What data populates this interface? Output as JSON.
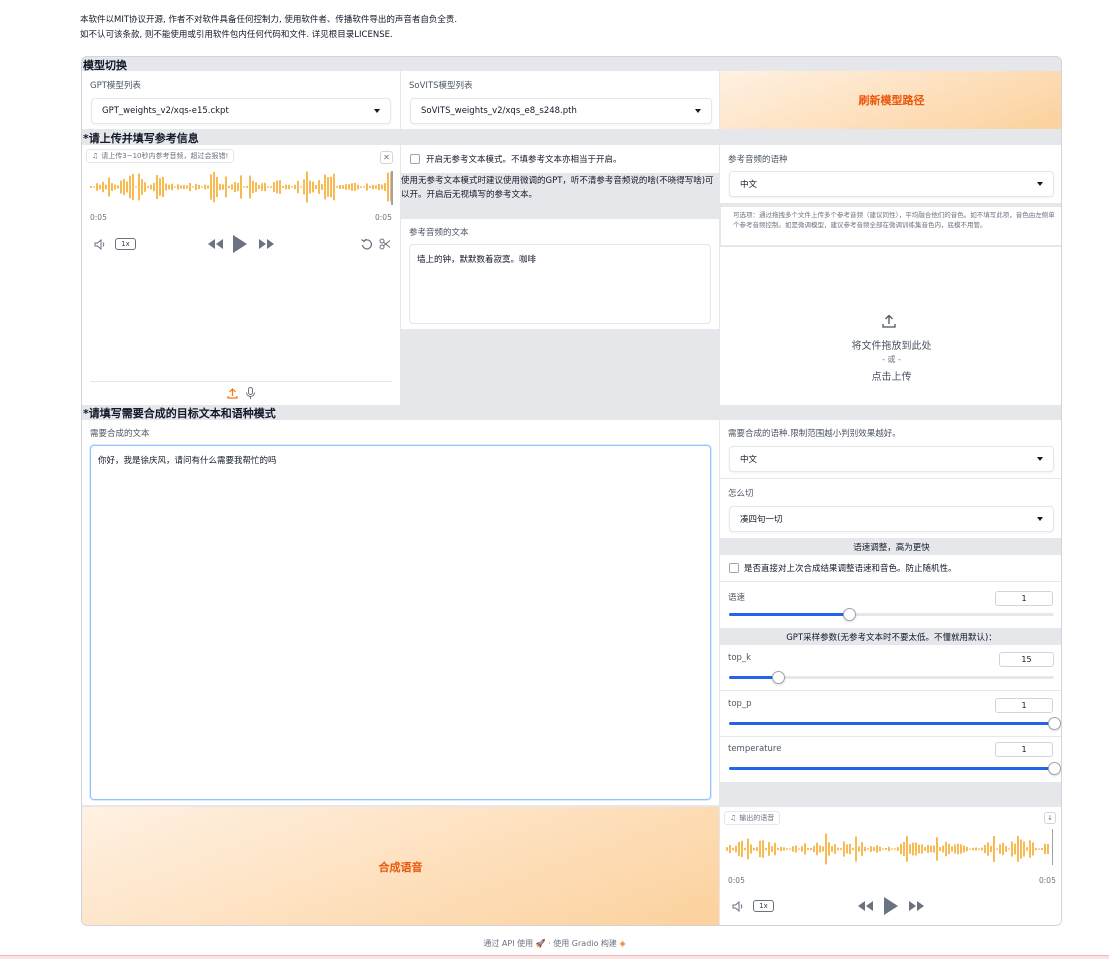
{
  "notice": {
    "line1": "本软件以MIT协议开源, 作者不对软件具备任何控制力, 使用软件者、传播软件导出的声音者自负全责.",
    "line2": "如不认可该条款, 则不能使用或引用软件包内任何代码和文件. 详见根目录LICENSE."
  },
  "model_switch": {
    "title": "模型切换",
    "gpt_label": "GPT模型列表",
    "gpt_value": "GPT_weights_v2/xqs-e15.ckpt",
    "sovits_label": "SoVITS模型列表",
    "sovits_value": "SoVITS_weights_v2/xqs_e8_s248.pth",
    "refresh_button": "刷新模型路径"
  },
  "reference": {
    "title": "*请上传并填写参考信息",
    "audio_chip": "请上传3~10秒内参考音频，超过会报错!",
    "audio_time_left": "0:05",
    "audio_time_right": "0:05",
    "audio_rate": "1x",
    "no_ref_checkbox_label": "开启无参考文本模式。不填参考文本亦相当于开启。",
    "no_ref_hint": "使用无参考文本模式时建议使用微调的GPT，听不清参考音频说的啥(不晓得写啥)可以开。开启后无视填写的参考文本。",
    "ref_text_label": "参考音频的文本",
    "ref_text_value": "墙上的钟，默默数着寂寞。咖啡",
    "ref_lang_label": "参考音频的语种",
    "ref_lang_value": "中文",
    "optional_hint": "可选项：通过拖拽多个文件上传多个参考音频（建议同性），平均融合他们的音色。如不填写此项，音色由左侧单个参考音频控制。如是微调模型，建议参考音频全部在微调训练集音色内，底模不用管。",
    "upload_line1": "将文件拖放到此处",
    "upload_line2": "- 或 -",
    "upload_line3": "点击上传"
  },
  "target": {
    "title": "*请填写需要合成的目标文本和语种模式",
    "text_label": "需要合成的文本",
    "text_value": "你好，我是徐庆风，请问有什么需要我帮忙的吗",
    "lang_label": "需要合成的语种.限制范围越小判别效果越好。",
    "lang_value": "中文",
    "cut_label": "怎么切",
    "cut_value": "凑四句一切",
    "speed_band": "语速调整，高为更快",
    "speed_checkbox_label": "是否直接对上次合成结果调整语速和音色。防止随机性。",
    "speed_label": "语速",
    "speed_value": "1",
    "speed_fraction": 0.37,
    "gpt_band": "GPT采样参数(无参考文本时不要太低。不懂就用默认)：",
    "topk_label": "top_k",
    "topk_value": "15",
    "topk_fraction": 0.15,
    "topp_label": "top_p",
    "topp_value": "1",
    "topp_fraction": 1.0,
    "temp_label": "temperature",
    "temp_value": "1",
    "temp_fraction": 1.0,
    "synth_button": "合成语音",
    "output_chip": "输出的语音",
    "output_time_left": "0:05",
    "output_time_right": "0:05",
    "output_rate": "1x"
  },
  "footer": {
    "api": "通过 API 使用",
    "sep": "·",
    "built": "使用 Gradio 构建"
  },
  "colors": {
    "accent_orange": "#ea580c",
    "wave_orange": "#f59e0b",
    "slider_blue": "#2563eb"
  }
}
